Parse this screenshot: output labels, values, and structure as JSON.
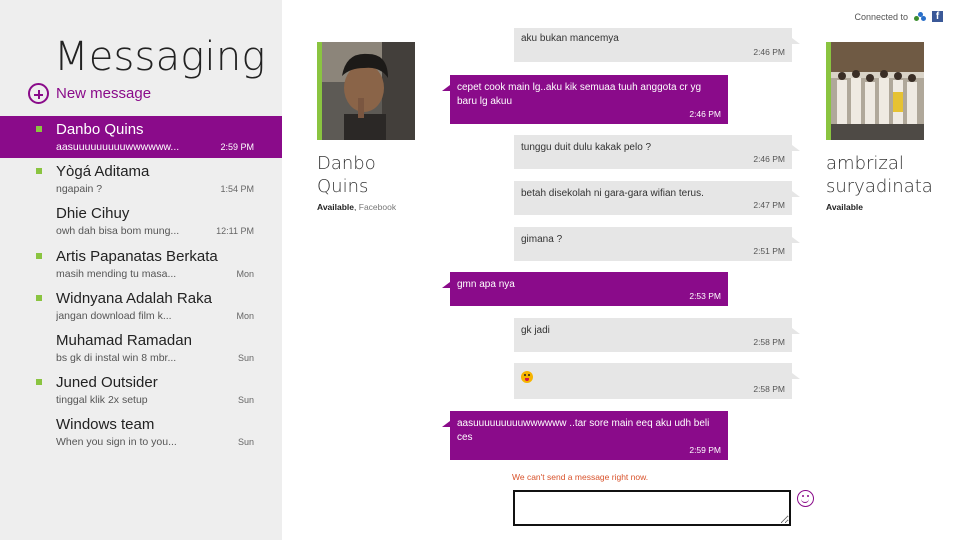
{
  "app": {
    "title": "Messaging",
    "new_message_label": "New message"
  },
  "conversations": [
    {
      "name": "Danbo Quins",
      "preview": "aasuuuuuuuuuwwwwww...",
      "time": "2:59 PM",
      "online": true,
      "selected": true
    },
    {
      "name": "Yògá Aditama",
      "preview": "ngapain ?",
      "time": "1:54 PM",
      "online": true,
      "selected": false
    },
    {
      "name": "Dhie Cihuy",
      "preview": "owh dah bisa bom mung...",
      "time": "12:11 PM",
      "online": false,
      "selected": false
    },
    {
      "name": "Artis Papanatas Berkata",
      "preview": "masih mending tu masa...",
      "time": "Mon",
      "online": true,
      "selected": false
    },
    {
      "name": "Widnyana Adalah Raka",
      "preview": "jangan download film k...",
      "time": "Mon",
      "online": true,
      "selected": false
    },
    {
      "name": "Muhamad Ramadan",
      "preview": "bs gk di instal win 8 mbr...",
      "time": "Sun",
      "online": false,
      "selected": false
    },
    {
      "name": "Juned Outsider",
      "preview": "tinggal klik 2x setup",
      "time": "Sun",
      "online": true,
      "selected": false
    },
    {
      "name": "Windows team",
      "preview": "When you sign in to you...",
      "time": "Sun",
      "online": false,
      "selected": false
    }
  ],
  "header": {
    "connected_label": "Connected to"
  },
  "contact_left": {
    "name_line1": "Danbo",
    "name_line2": "Quins",
    "status": "Available",
    "separator": ", ",
    "network": "Facebook"
  },
  "contact_right": {
    "name_line1": "ambrizal",
    "name_line2": "suryadinata",
    "status": "Available"
  },
  "messages": [
    {
      "direction": "in",
      "text": "aku bukan mancemya",
      "time": "2:46 PM"
    },
    {
      "direction": "out",
      "text": "cepet cook main lg..aku kik semuaa tuuh anggota cr yg baru lg akuu",
      "time": "2:46 PM"
    },
    {
      "direction": "in",
      "text": "tunggu duit dulu kakak pelo ?",
      "time": "2:46 PM"
    },
    {
      "direction": "in",
      "text": "betah disekolah ni gara-gara wifian terus.",
      "time": "2:47 PM"
    },
    {
      "direction": "in",
      "text": "gimana ?",
      "time": "2:51 PM"
    },
    {
      "direction": "out",
      "text": "gmn apa nya",
      "time": "2:53 PM"
    },
    {
      "direction": "in",
      "text": "gk jadi",
      "time": "2:58 PM"
    },
    {
      "direction": "in",
      "text": "",
      "emoji": "tongue-face",
      "time": "2:58 PM"
    },
    {
      "direction": "out",
      "text": "aasuuuuuuuuuwwwwww ..tar sore main eeq aku udh beli ces",
      "time": "2:59 PM"
    }
  ],
  "compose": {
    "error": "We can't send a message right now.",
    "value": "",
    "placeholder": ""
  },
  "colors": {
    "accent": "#8a0b8a",
    "online": "#8ac440",
    "pane_bg": "#eeeeee",
    "incoming_bubble": "#e6e6e6",
    "error": "#d9532c",
    "facebook": "#3b5998"
  },
  "icons": {
    "new_message": "plus-circle-icon",
    "messenger": "messenger-icon",
    "facebook": "facebook-icon",
    "emoticon": "smiley-icon"
  }
}
